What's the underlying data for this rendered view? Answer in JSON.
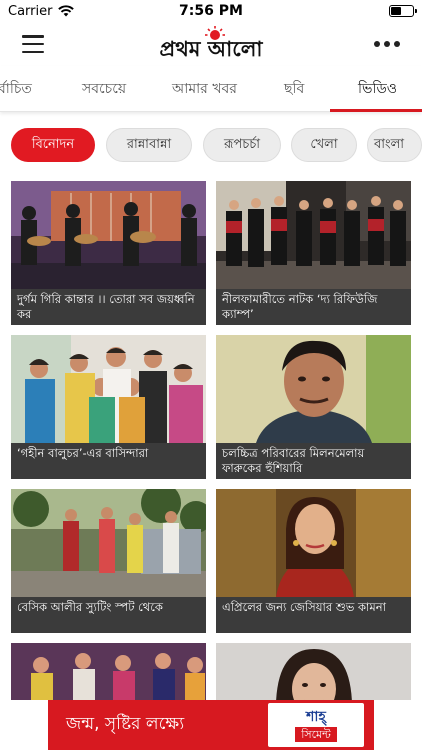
{
  "status_bar": {
    "carrier": "Carrier",
    "time": "7:56 PM"
  },
  "header": {
    "logo_text": "প্রথম আলো"
  },
  "tabs": [
    {
      "label": "র্বাচিত"
    },
    {
      "label": "সবচেয়ে"
    },
    {
      "label": "আমার খবর"
    },
    {
      "label": "ছবি"
    },
    {
      "label": "ভিডিও"
    }
  ],
  "active_tab": "ভিডিও",
  "chips": [
    {
      "label": "বিনোদন"
    },
    {
      "label": "রান্নাবান্না"
    },
    {
      "label": "রূপচর্চা"
    },
    {
      "label": "খেলা"
    },
    {
      "label": "বাংলা"
    }
  ],
  "active_chip": "বিনোদন",
  "videos": [
    {
      "caption": "দুর্গম গিরি কান্তার ।। তোরা সব জয়ধ্বনি কর"
    },
    {
      "caption": "নীলফামারীতে নাটক ‘দ্য রিফিউজি ক্যাম্প’"
    },
    {
      "caption": "‘গহীন বালুচর’-এর বাসিন্দারা"
    },
    {
      "caption": "চলচ্চিত্র পরিবারের মিলনমেলায় ফারুকের হুঁশিয়ারি"
    },
    {
      "caption": "বেসিক আলীর স্যুটিং স্পট থেকে"
    },
    {
      "caption": "এপ্রিলের জন্য জেসিয়ার শুভ কামনা"
    },
    {
      "caption": ""
    },
    {
      "caption": ""
    }
  ],
  "ad": {
    "text": "জন্ম, সৃষ্টির লক্ষ্যে",
    "brand_top": "শাহ্",
    "brand_bottom": "সিমেন্ট"
  },
  "colors": {
    "accent": "#d71920",
    "caption_bg": "#3b3b3b",
    "chip_bg": "#ececec"
  },
  "icons": [
    "wifi-icon",
    "battery-icon",
    "hamburger-menu-icon",
    "more-options-icon",
    "sun-logo-icon"
  ]
}
